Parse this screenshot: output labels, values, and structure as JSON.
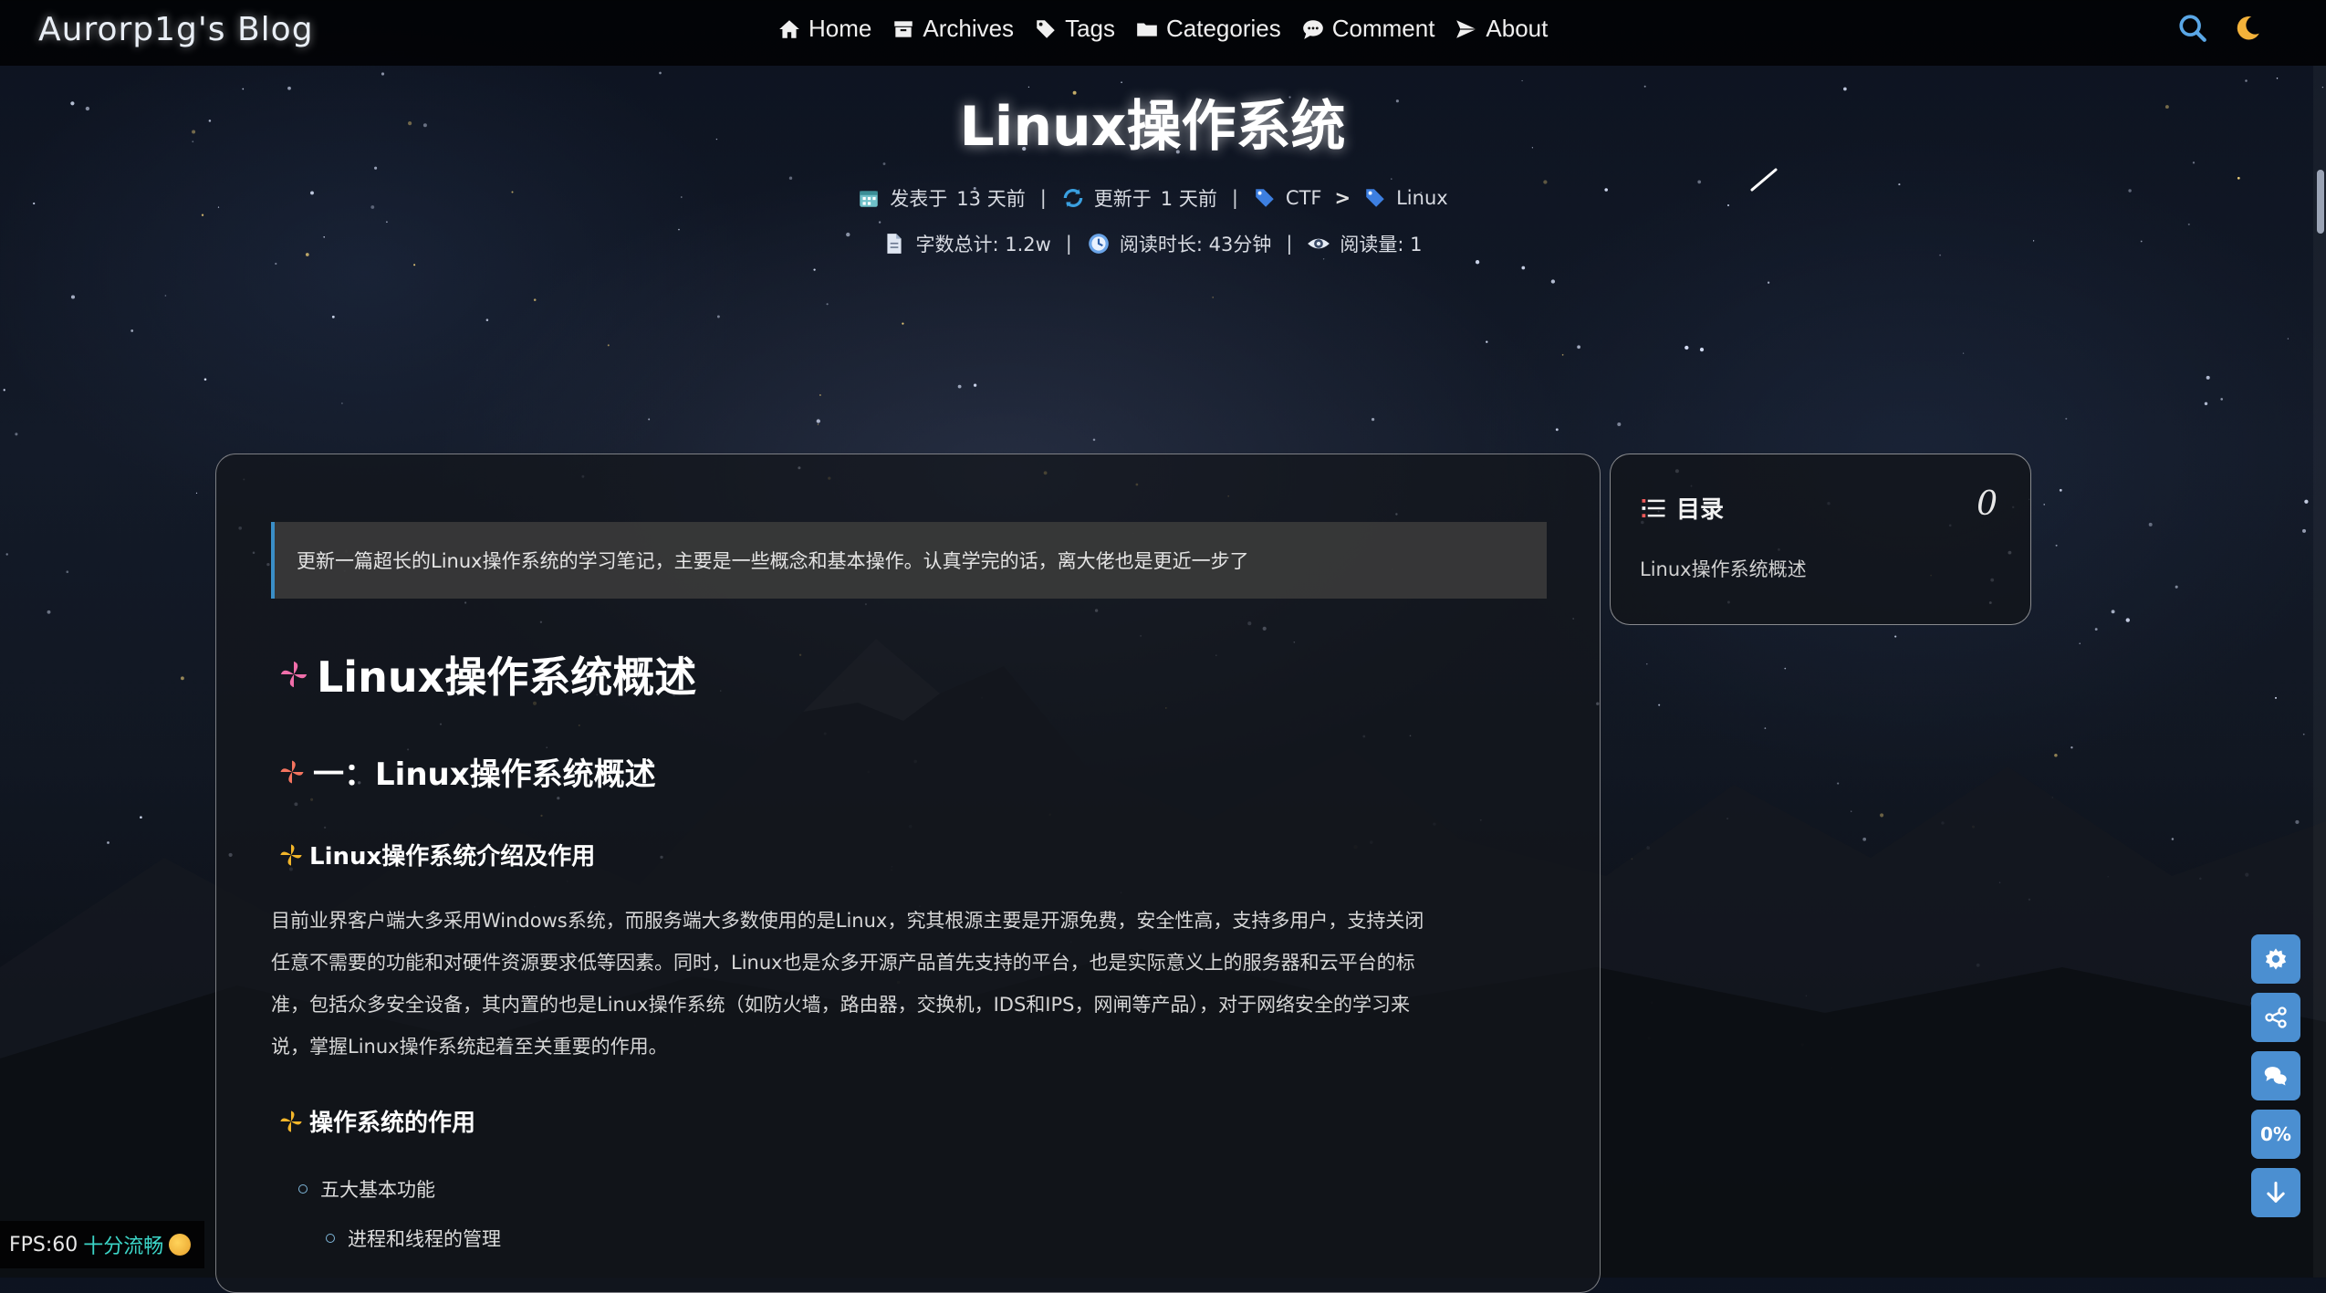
{
  "header": {
    "blog_title": "Aurorp1g's Blog",
    "nav": [
      {
        "label": "Home",
        "icon": "home-icon"
      },
      {
        "label": "Archives",
        "icon": "archive-icon"
      },
      {
        "label": "Tags",
        "icon": "tags-icon"
      },
      {
        "label": "Categories",
        "icon": "folder-icon"
      },
      {
        "label": "Comment",
        "icon": "comment-icon"
      },
      {
        "label": "About",
        "icon": "paper-plane-icon"
      }
    ],
    "right_icons": [
      "search-icon",
      "moon-icon"
    ]
  },
  "post": {
    "title": "Linux操作系统",
    "meta_row1": {
      "published_label": "发表于",
      "published_value": "13 天前",
      "updated_label": "更新于",
      "updated_value": "1 天前",
      "category": "CTF",
      "tag": "Linux"
    },
    "meta_row2": {
      "word_count": "字数总计: 1.2w",
      "reading_time": "阅读时长: 43分钟",
      "views": "阅读量: 1"
    }
  },
  "content": {
    "note": "更新一篇超长的Linux操作系统的学习笔记，主要是一些概念和基本操作。认真学完的话，离大佬也是更近一步了",
    "h1": "Linux操作系统概述",
    "h2": "一：Linux操作系统概述",
    "h3_1": "Linux操作系统介绍及作用",
    "paragraph_lines": [
      "目前业界客户端大多采用Windows系统，而服务端大多数使用的是Linux，究其根源主要是开源免费，安全性高，支持多用户，支持关闭",
      "任意不需要的功能和对硬件资源要求低等因素。同时，Linux也是众多开源产品首先支持的平台，也是实际意义上的服务器和云平台的标",
      "准，包括众多安全设备，其内置的也是Linux操作系统（如防火墙，路由器，交换机，IDS和IPS，网闸等产品），对于网络安全的学习来",
      "说，掌握Linux操作系统起着至关重要的作用。"
    ],
    "h3_2": "操作系统的作用",
    "list_item_1": "五大基本功能",
    "list_item_2": "进程和线程的管理"
  },
  "toc": {
    "title": "目录",
    "percent": "0",
    "items": [
      "Linux操作系统概述"
    ]
  },
  "side_buttons": {
    "percent_label": "0%",
    "icons": [
      "gear-icon",
      "share-icon",
      "comments-icon",
      "arrow-down-icon"
    ]
  },
  "fps": {
    "label": "FPS:60",
    "status": "十分流畅"
  },
  "colors": {
    "accent_blue": "#4b8fd1",
    "note_border": "#3a8ec7",
    "fps_status": "#3cd6c8"
  }
}
